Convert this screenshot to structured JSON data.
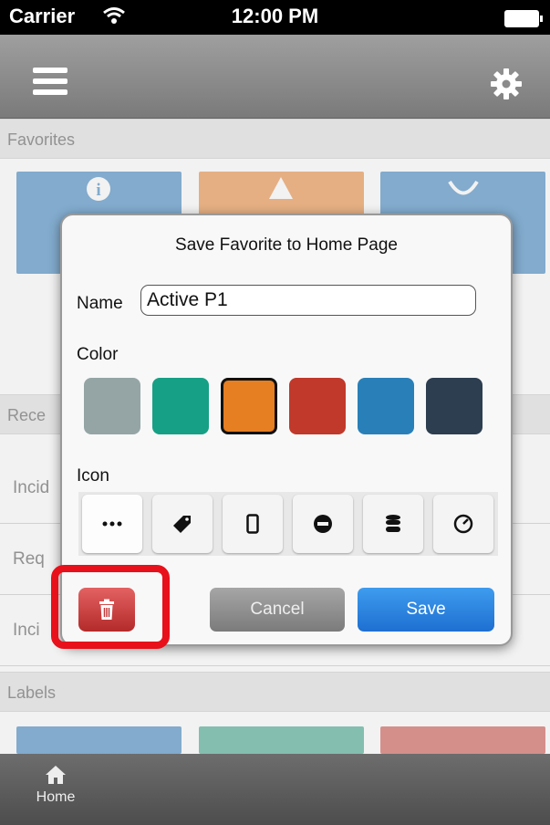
{
  "status_bar": {
    "carrier": "Carrier",
    "time": "12:00 PM"
  },
  "nav": {
    "menu_icon": "hamburger-icon",
    "settings_icon": "gear-icon"
  },
  "sections": {
    "favorites": "Favorites",
    "recent_partial": "Rece",
    "labels": "Labels"
  },
  "list_rows": [
    "Incid",
    "Req",
    "Inci"
  ],
  "favorite_tiles": [
    {
      "color": "#8ab5d8",
      "icon": "info-icon"
    },
    {
      "color": "#f2b98b",
      "icon": "warning-icon"
    },
    {
      "color": "#8ab5d8",
      "icon": "curve-icon"
    }
  ],
  "label_tiles": [
    {
      "color": "#8ab5d8"
    },
    {
      "color": "#8cc9b9"
    },
    {
      "color": "#e09793"
    }
  ],
  "modal": {
    "title": "Save Favorite to Home Page",
    "name_label": "Name",
    "name_value": "Active P1",
    "color_label": "Color",
    "colors": [
      "#95a5a6",
      "#16a085",
      "#e67e22",
      "#c0392b",
      "#2980b9",
      "#2c3e50"
    ],
    "selected_color_index": 2,
    "icon_label": "Icon",
    "icons": [
      "ellipsis-icon",
      "tag-icon",
      "mobile-icon",
      "minus-circle-icon",
      "database-icon",
      "dashboard-icon"
    ],
    "selected_icon_index": 0,
    "cancel_label": "Cancel",
    "save_label": "Save",
    "delete_icon": "trash-icon"
  },
  "tabbar": {
    "home_label": "Home",
    "home_icon": "home-icon"
  }
}
